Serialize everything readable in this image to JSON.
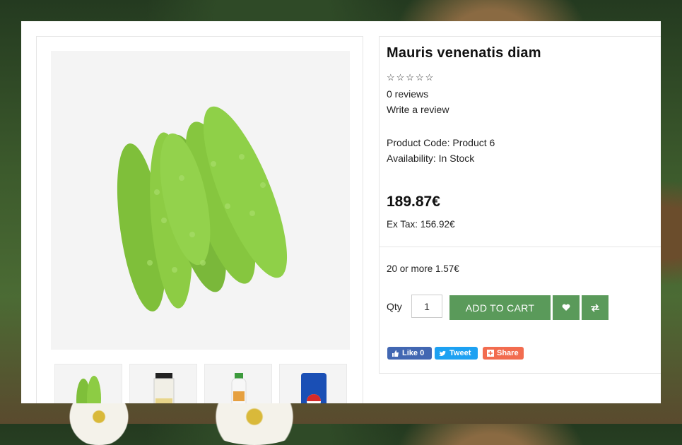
{
  "product": {
    "title": "Mauris venenatis diam",
    "rating_stars": "☆☆☆☆☆",
    "reviews": "0 reviews",
    "write_review": "Write a review",
    "product_code": "Product Code: Product 6",
    "availability": "Availability: In Stock",
    "price": "189.87€",
    "ex_tax": "Ex Tax: 156.92€",
    "discount": "20 or more 1.57€"
  },
  "cart": {
    "qty_label": "Qty",
    "qty_value": "1",
    "add_to_cart": "ADD TO CART"
  },
  "social": {
    "like": "Like 0",
    "tweet": "Tweet",
    "share": "Share"
  },
  "icons": {
    "wishlist": "heart-icon",
    "compare": "compare-arrows-icon"
  },
  "colors": {
    "accent": "#5a9a5a",
    "facebook": "#4267b2",
    "twitter": "#1da1f2",
    "share": "#f26c4f"
  }
}
